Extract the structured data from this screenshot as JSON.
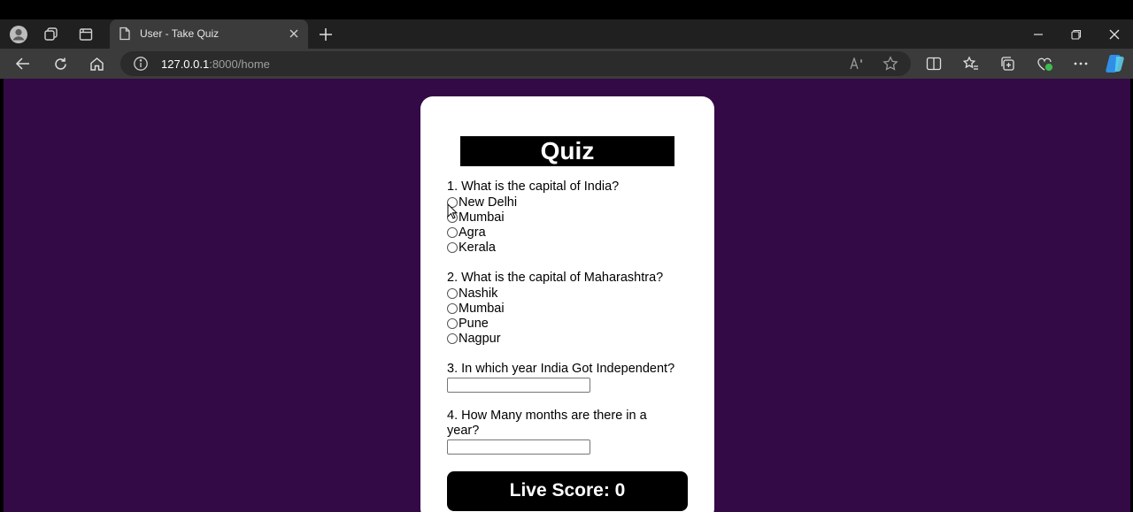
{
  "browser": {
    "tab_title": "User - Take Quiz",
    "address_host": "127.0.0.1",
    "address_rest": ":8000/home"
  },
  "quiz": {
    "title": "Quiz",
    "questions": [
      {
        "text": "1. What is the capital of India?",
        "options": [
          "New Delhi",
          "Mumbai",
          "Agra",
          "Kerala"
        ]
      },
      {
        "text": "2. What is the capital of Maharashtra?",
        "options": [
          "Nashik",
          "Mumbai",
          "Pune",
          "Nagpur"
        ]
      },
      {
        "text": "3. In which year India Got Independent?",
        "answer": ""
      },
      {
        "text_line1": "4. How Many months are there in a",
        "text_line2": "year?",
        "answer": ""
      }
    ],
    "score_label": "Live Score: 0"
  },
  "colors": {
    "page_background": "#330a46",
    "card_background": "#ffffff",
    "title_background": "#000000"
  }
}
